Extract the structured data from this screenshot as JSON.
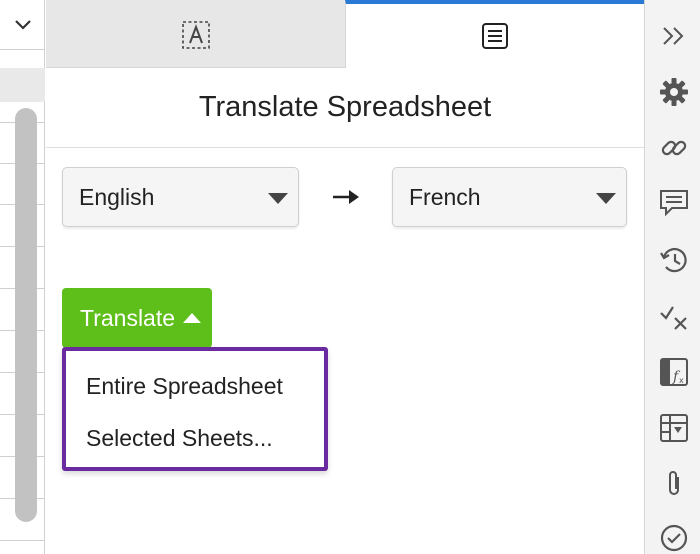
{
  "left_strip": {
    "dropdown_icon": "chevron-down-icon"
  },
  "tabs": [
    {
      "name": "text-format",
      "icon": "text-box-icon",
      "active": false
    },
    {
      "name": "document",
      "icon": "document-list-icon",
      "active": true
    }
  ],
  "panel": {
    "title": "Translate Spreadsheet",
    "from_language": "English",
    "to_language": "French",
    "arrow_icon": "arrow-right-icon",
    "translate_button_label": "Translate",
    "menu_items": [
      "Entire Spreadsheet",
      "Selected Sheets..."
    ]
  },
  "rail": {
    "icons": [
      "double-chevron-right-icon",
      "gear-icon",
      "link-icon",
      "comment-icon",
      "history-icon",
      "check-x-icon",
      "function-icon",
      "table-dropdown-icon",
      "paperclip-icon",
      "check-circle-icon"
    ]
  },
  "colors": {
    "accent_blue": "#2a7ad5",
    "translate_green": "#5fbf1a",
    "menu_border_purple": "#6a2aa0"
  }
}
